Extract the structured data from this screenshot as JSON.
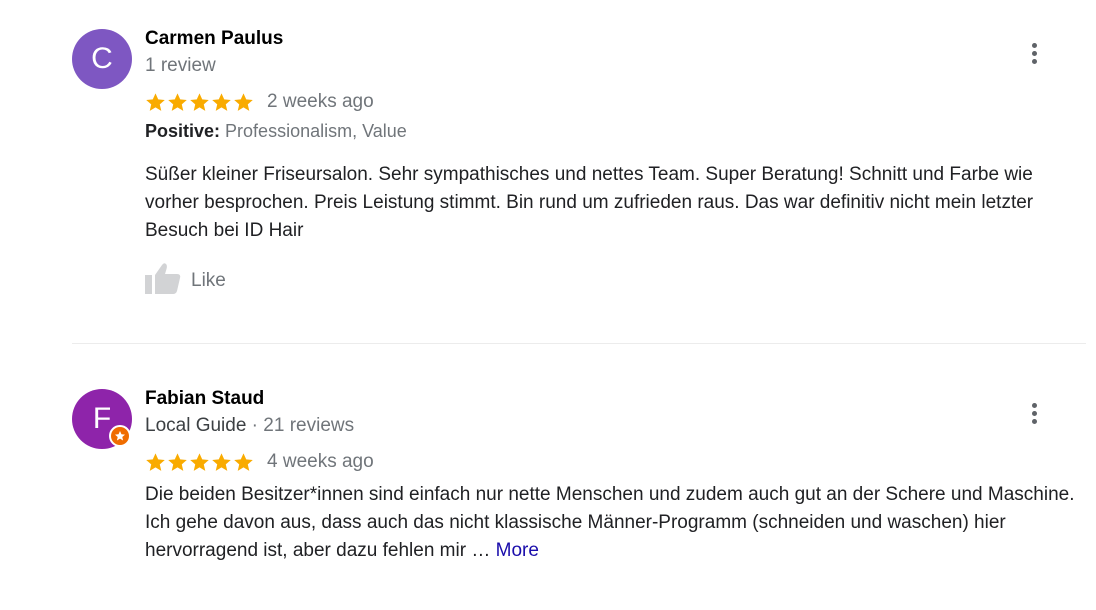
{
  "reviews": [
    {
      "avatar_letter": "C",
      "avatar_color": "#7e57c2",
      "name": "Carmen Paulus",
      "review_count": "1 review",
      "rating": 5,
      "date": "2 weeks ago",
      "positive_label": "Positive:",
      "positive_values": "Professionalism, Value",
      "text": "Süßer kleiner Friseursalon. Sehr sympathisches und nettes Team. Super Beratung! Schnitt und Farbe wie vorher besprochen. Preis Leistung stimmt. Bin rund um zufrieden raus. Das war definitiv nicht mein letzter Besuch bei ID Hair",
      "like_label": "Like"
    },
    {
      "avatar_letter": "F",
      "avatar_color": "#8e24aa",
      "name": "Fabian Staud",
      "local_guide": "Local Guide",
      "separator": " · ",
      "review_count": "21 reviews",
      "rating": 5,
      "date": "4 weeks ago",
      "text": "Die beiden Besitzer*innen sind einfach nur nette Menschen und zudem auch gut an der Schere und Maschine. Ich gehe davon aus, dass auch das nicht klassische Männer-Programm (schneiden und waschen) hier hervorragend ist, aber dazu fehlen mir … ",
      "more_label": "More"
    }
  ],
  "colors": {
    "star": "#f9ab00",
    "secondary_text": "#70757a",
    "link": "#1a0dab",
    "local_guide_badge": "#ef6c00"
  },
  "icons": {
    "star": "star-icon",
    "kebab": "more-vert-icon",
    "like": "thumbs-up-icon",
    "badge": "local-guide-badge-icon"
  }
}
